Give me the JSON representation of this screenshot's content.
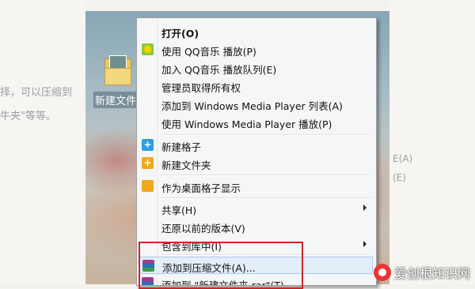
{
  "background": {
    "left_text": [
      "择，可以压缩到",
      "牛夹\"等等。"
    ],
    "right_text": [
      "E(A)",
      "(E)"
    ]
  },
  "desktop_icon": {
    "label": "新建文件夹",
    "icon": "folder-icon"
  },
  "context_menu": {
    "items": [
      {
        "label": "打开(O)",
        "bold": true
      },
      {
        "label": "使用 QQ音乐 播放(P)",
        "icon": "qq-music-icon"
      },
      {
        "label": "加入 QQ音乐 播放队列(E)"
      },
      {
        "label": "管理员取得所有权"
      },
      {
        "label": "添加到 Windows Media Player 列表(A)"
      },
      {
        "label": "使用 Windows Media Player 播放(P)"
      },
      {
        "label": "新建格子",
        "icon": "plus-blue-icon"
      },
      {
        "label": "新建文件夹",
        "icon": "plus-orange-icon"
      },
      {
        "label": "作为桌面格子显示",
        "icon": "grid-icon"
      },
      {
        "label": "共享(H)",
        "submenu": true
      },
      {
        "label": "还原以前的版本(V)"
      },
      {
        "label": "包含到库中(I)",
        "submenu": true
      },
      {
        "label": "添加到压缩文件(A)...",
        "icon": "winrar-icon",
        "highlighted": true
      },
      {
        "label": "添加到 \"新建文件夹.rar\"(T)",
        "icon": "winrar-icon"
      }
    ]
  },
  "watermark": {
    "text": "爱创根知识网"
  },
  "colors": {
    "highlight_box": "#c8292b",
    "menu_hover": "#e3eef8"
  }
}
